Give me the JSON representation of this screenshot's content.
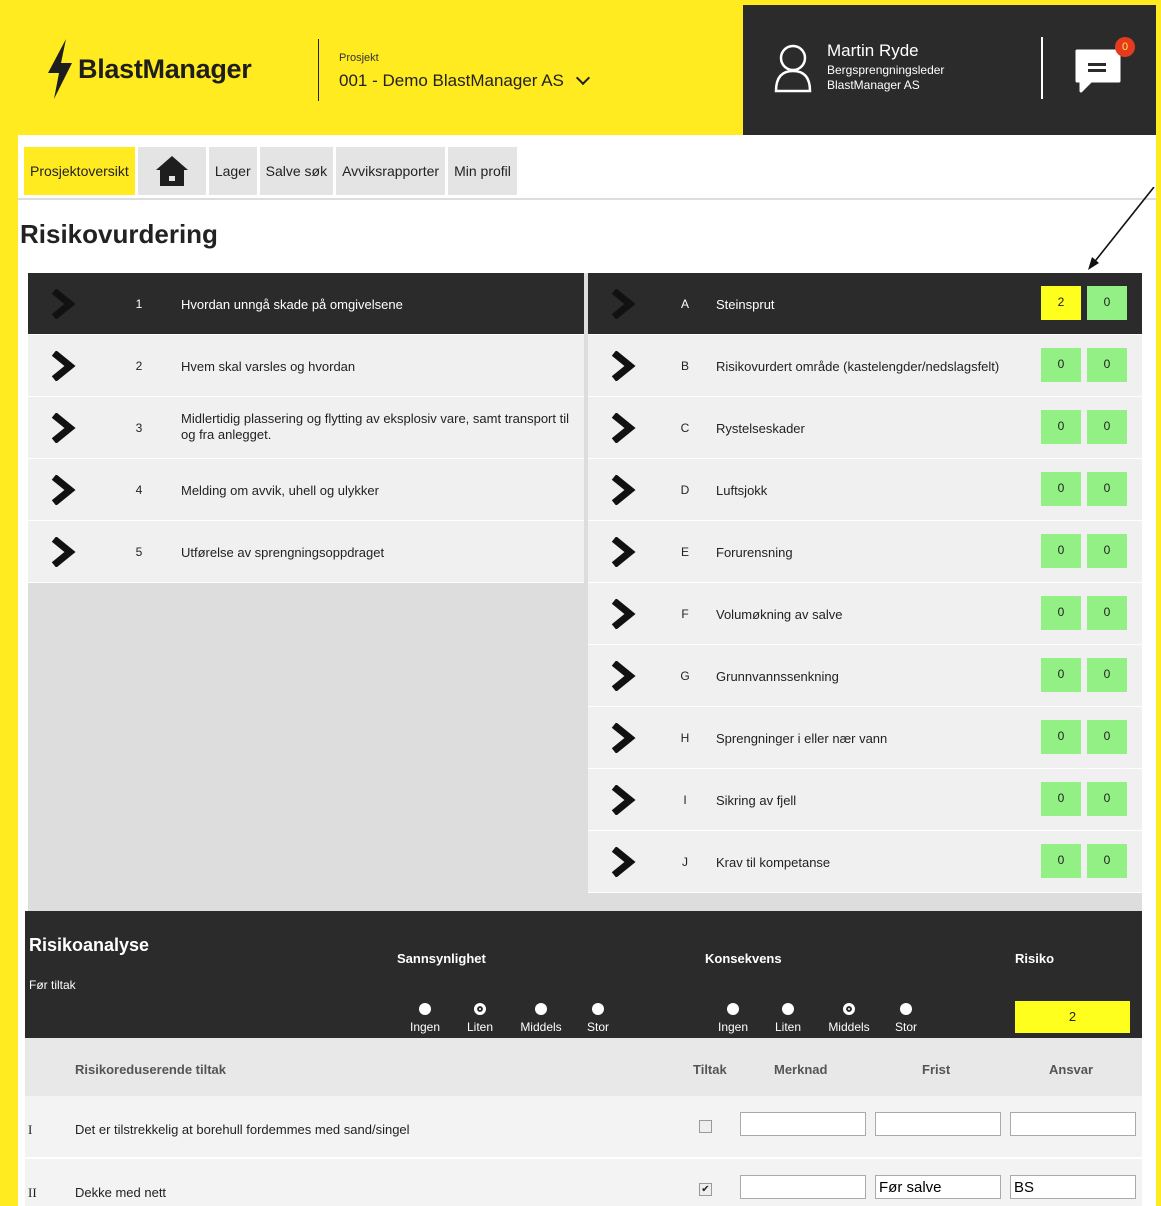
{
  "header": {
    "app_name": "BlastManager",
    "project_label": "Prosjekt",
    "project_name": "001 - Demo BlastManager AS",
    "user_name": "Martin Ryde",
    "user_role": "Bergsprengningsleder",
    "user_company": "BlastManager AS",
    "notification_count": "0"
  },
  "nav": {
    "items": [
      "Prosjektoversikt",
      "Lager",
      "Salve søk",
      "Avviksrapporter",
      "Min profil"
    ]
  },
  "page_title": "Risikovurdering",
  "left_list": [
    {
      "num": "1",
      "label": "Hvordan unngå skade på omgivelsene"
    },
    {
      "num": "2",
      "label": "Hvem skal varsles og hvordan"
    },
    {
      "num": "3",
      "label": "Midlertidig plassering og flytting av eksplosiv vare, samt transport til og fra anlegget."
    },
    {
      "num": "4",
      "label": "Melding om avvik, uhell og ulykker"
    },
    {
      "num": "5",
      "label": "Utførelse av sprengningsoppdraget"
    }
  ],
  "right_list": [
    {
      "letter": "A",
      "label": "Steinsprut",
      "score1": "2",
      "score2": "0"
    },
    {
      "letter": "B",
      "label": "Risikovurdert område (kastelengder/nedslagsfelt)",
      "score1": "0",
      "score2": "0"
    },
    {
      "letter": "C",
      "label": "Rystelseskader",
      "score1": "0",
      "score2": "0"
    },
    {
      "letter": "D",
      "label": "Luftsjokk",
      "score1": "0",
      "score2": "0"
    },
    {
      "letter": "E",
      "label": "Forurensning",
      "score1": "0",
      "score2": "0"
    },
    {
      "letter": "F",
      "label": "Volumøkning av salve",
      "score1": "0",
      "score2": "0"
    },
    {
      "letter": "G",
      "label": "Grunnvannssenkning",
      "score1": "0",
      "score2": "0"
    },
    {
      "letter": "H",
      "label": "Sprengninger i eller nær vann",
      "score1": "0",
      "score2": "0"
    },
    {
      "letter": "I",
      "label": "Sikring av fjell",
      "score1": "0",
      "score2": "0"
    },
    {
      "letter": "J",
      "label": "Krav til kompetanse",
      "score1": "0",
      "score2": "0"
    }
  ],
  "analysis": {
    "title": "Risikoanalyse",
    "subtitle": "Før tiltak",
    "probability_title": "Sannsynlighet",
    "consequence_title": "Konsekvens",
    "risk_title": "Risiko",
    "probability_options": [
      "Ingen",
      "Liten",
      "Middels",
      "Stor"
    ],
    "probability_selected": "Liten",
    "consequence_options": [
      "Ingen",
      "Liten",
      "Middels",
      "Stor"
    ],
    "consequence_selected": "Middels",
    "risk_value": "2"
  },
  "measures": {
    "headers": {
      "measure": "Risikoreduserende tiltak",
      "tiltak": "Tiltak",
      "merknad": "Merknad",
      "frist": "Frist",
      "ansvar": "Ansvar"
    },
    "rows": [
      {
        "num": "I",
        "text": "Det er tilstrekkelig at borehull fordemmes med sand/singel",
        "checked": false,
        "merknad": "",
        "frist": "",
        "ansvar": ""
      },
      {
        "num": "II",
        "text": "Dekke med nett",
        "checked": true,
        "merknad": "",
        "frist": "Før salve",
        "ansvar": "BS"
      }
    ]
  },
  "colors": {
    "brand_yellow": "#ffeb1f",
    "dark": "#2b2b2b",
    "score_green": "#92f084",
    "score_yellow": "#ffff1e"
  }
}
